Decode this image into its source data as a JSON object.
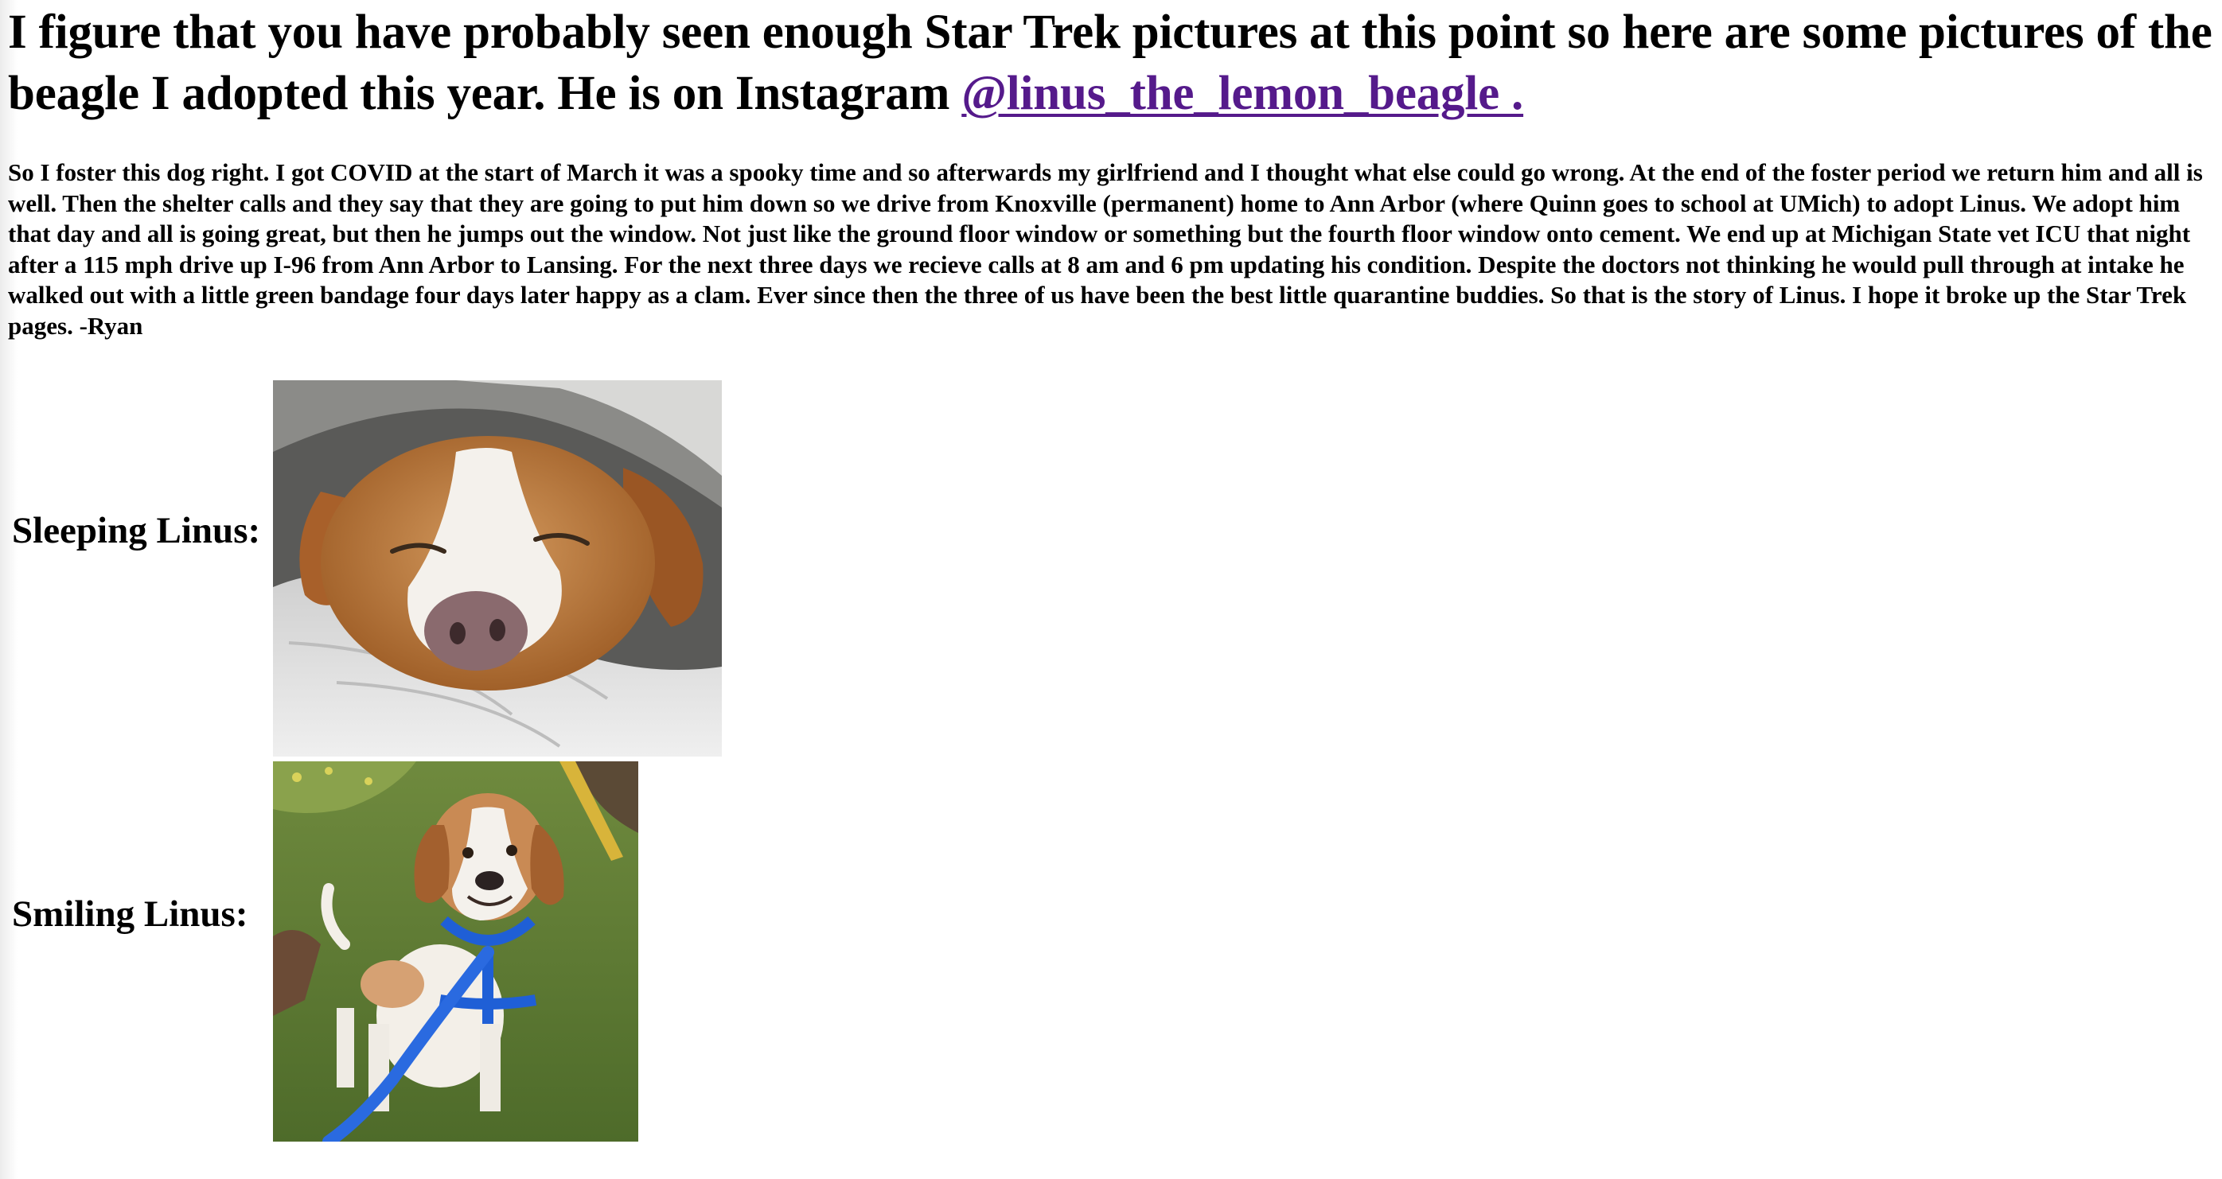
{
  "headline": {
    "text": "I figure that you have probably seen enough Star Trek pictures at this point so here are some pictures of the beagle I adopted this year. He is on Instagram ",
    "link_label": "@linus_the_lemon_beagle ."
  },
  "story": "So I foster this dog right. I got COVID at the start of March it was a spooky time and so afterwards my girlfriend and I thought what else could go wrong. At the end of the foster period we return him and all is well. Then the shelter calls and they say that they are going to put him down so we drive from Knoxville (permanent) home to Ann Arbor (where Quinn goes to school at UMich) to adopt Linus. We adopt him that day and all is going great, but then he jumps out the window. Not just like the ground floor window or something but the fourth floor window onto cement. We end up at Michigan State vet ICU that night after a 115 mph drive up I-96 from Ann Arbor to Lansing. For the next three days we recieve calls at 8 am and 6 pm updating his condition. Despite the doctors not thinking he would pull through at intake he walked out with a little green bandage four days later happy as a clam. Ever since then the three of us have been the best little quarantine buddies. So that is the story of Linus. I hope it broke up the Star Trek pages. -Ryan",
  "photos": [
    {
      "label": "Sleeping Linus:"
    },
    {
      "label": "Smiling Linus:"
    }
  ],
  "colors": {
    "link": "#551a8b",
    "text": "#000000",
    "background": "#ffffff"
  }
}
